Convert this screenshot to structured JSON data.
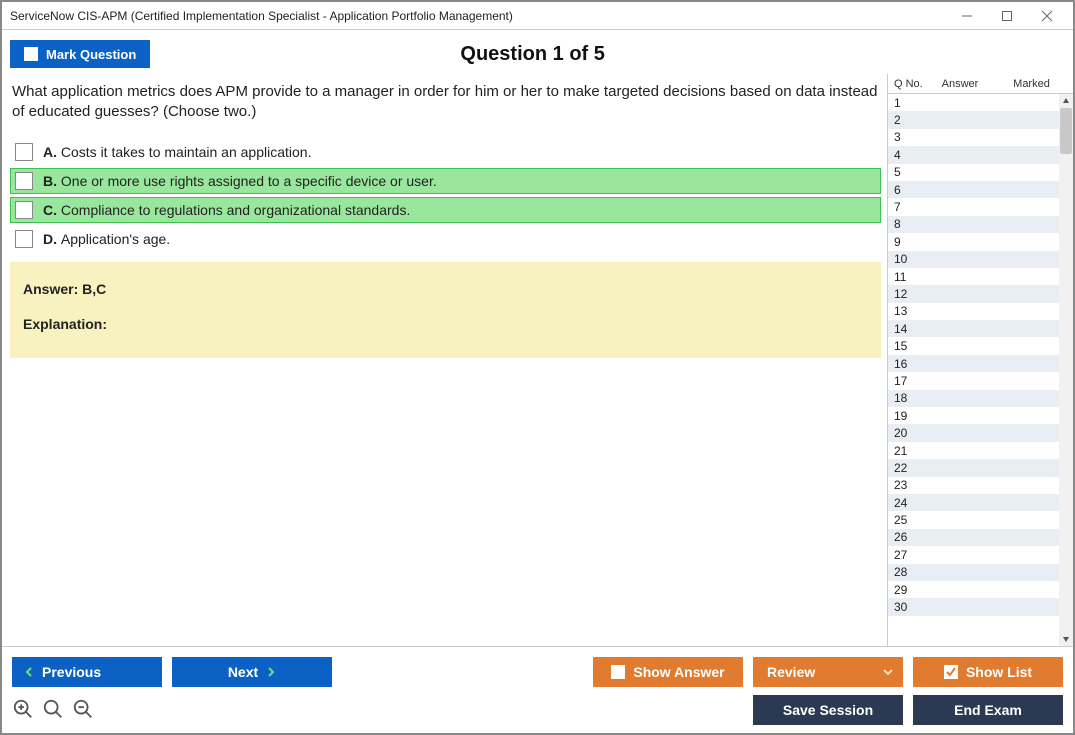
{
  "window": {
    "title": "ServiceNow CIS-APM (Certified Implementation Specialist - Application Portfolio Management)"
  },
  "top": {
    "mark_label": "Mark Question",
    "question_heading": "Question 1 of 5"
  },
  "question": {
    "text": "What application metrics does APM provide to a manager in order for him or her to make targeted decisions based on data instead of educated guesses? (Choose two.)",
    "options": [
      {
        "letter": "A.",
        "text": "Costs it takes to maintain an application.",
        "highlight": false
      },
      {
        "letter": "B.",
        "text": "One or more use rights assigned to a specific device or user.",
        "highlight": true
      },
      {
        "letter": "C.",
        "text": "Compliance to regulations and organizational standards.",
        "highlight": true
      },
      {
        "letter": "D.",
        "text": "Application's age.",
        "highlight": false
      }
    ]
  },
  "answer_panel": {
    "answer_label": "Answer: B,C",
    "explanation_label": "Explanation:"
  },
  "qlist": {
    "header": {
      "qno": "Q No.",
      "answer": "Answer",
      "marked": "Marked"
    },
    "rows": [
      {
        "n": "1"
      },
      {
        "n": "2"
      },
      {
        "n": "3"
      },
      {
        "n": "4"
      },
      {
        "n": "5"
      },
      {
        "n": "6"
      },
      {
        "n": "7"
      },
      {
        "n": "8"
      },
      {
        "n": "9"
      },
      {
        "n": "10"
      },
      {
        "n": "11"
      },
      {
        "n": "12"
      },
      {
        "n": "13"
      },
      {
        "n": "14"
      },
      {
        "n": "15"
      },
      {
        "n": "16"
      },
      {
        "n": "17"
      },
      {
        "n": "18"
      },
      {
        "n": "19"
      },
      {
        "n": "20"
      },
      {
        "n": "21"
      },
      {
        "n": "22"
      },
      {
        "n": "23"
      },
      {
        "n": "24"
      },
      {
        "n": "25"
      },
      {
        "n": "26"
      },
      {
        "n": "27"
      },
      {
        "n": "28"
      },
      {
        "n": "29"
      },
      {
        "n": "30"
      }
    ]
  },
  "buttons": {
    "previous": "Previous",
    "next": "Next",
    "show_answer": "Show Answer",
    "review": "Review",
    "show_list": "Show List",
    "save_session": "Save Session",
    "end_exam": "End Exam"
  }
}
